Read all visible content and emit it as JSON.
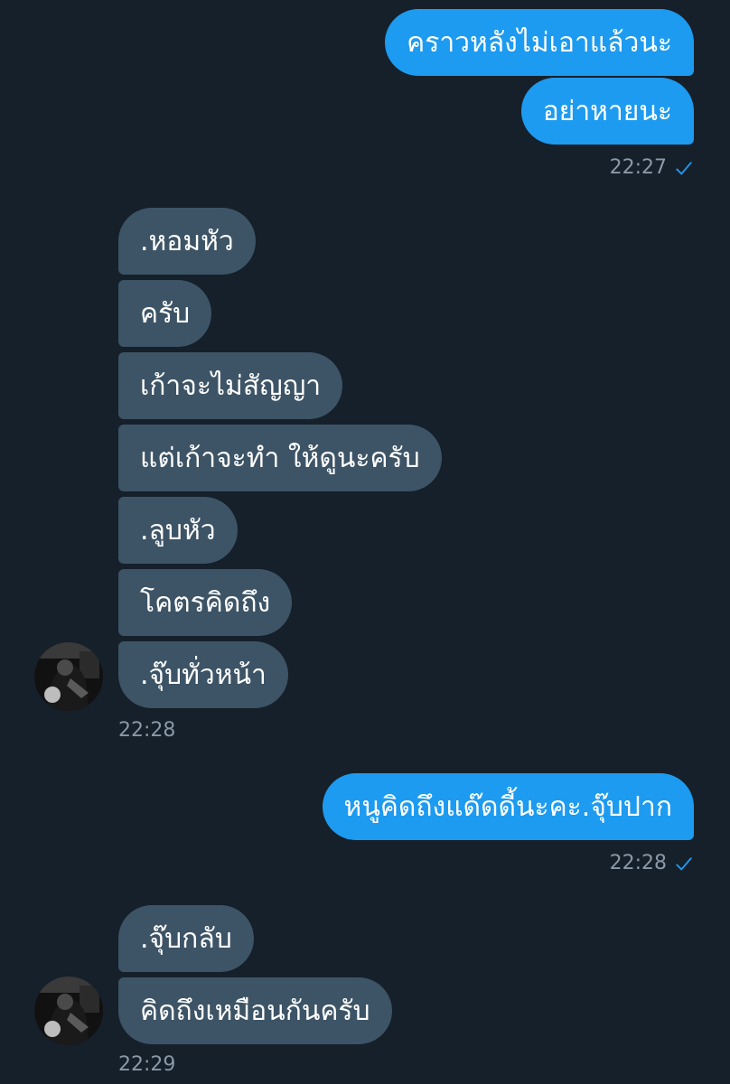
{
  "colors": {
    "background": "#15202b",
    "outgoing_bubble": "#1d9bf0",
    "incoming_bubble": "#3d5466",
    "timestamp": "#8b98a5",
    "check": "#1d9bf0"
  },
  "messages": {
    "out1": "คราวหลังไม่เอาแล้วนะ",
    "out2": "อย่าหายนะ",
    "time1": "22:27",
    "in1": ".หอมหัว",
    "in2": "ครับ",
    "in3": "เก้าจะไม่สัญญา",
    "in4": "แต่เก้าจะทำ ให้ดูนะครับ",
    "in5": ".ลูบหัว",
    "in6": "โคตรคิดถึง",
    "in7": ".จุ๊บทั่วหน้า",
    "time2": "22:28",
    "out3": "หนูคิดถึงแด๊ดดี้นะคะ.จุ๊บปาก",
    "time3": "22:28",
    "in8": ".จุ๊บกลับ",
    "in9": "คิดถึงเหมือนกันครับ",
    "time4": "22:29"
  },
  "icons": {
    "read_receipt": "check-icon",
    "avatar": "profile-avatar"
  }
}
